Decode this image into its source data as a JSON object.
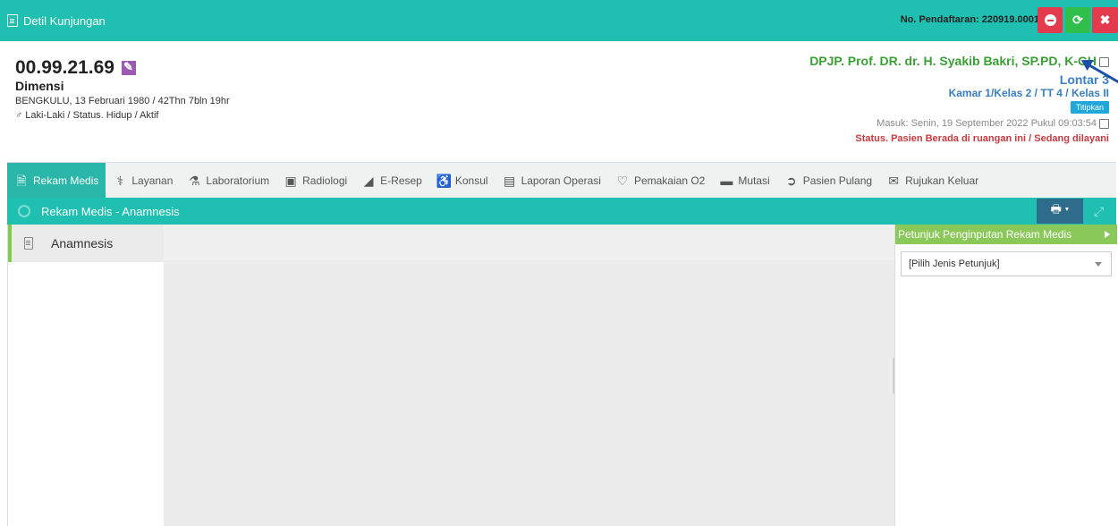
{
  "header": {
    "title": "Detil Kunjungan",
    "registration": "No. Pendaftaran: 220919.0001",
    "buttons": {
      "cancel_icon": "minus-circle-icon",
      "refresh_icon": "refresh-icon",
      "close_icon": "close-icon"
    }
  },
  "patient": {
    "id": "00.99.21.69",
    "name": "Dimensi",
    "dob": "BENGKULU, 13 Februari 1980 / 42Thn 7bln 19hr",
    "gender_status": "♂ Laki-Laki / Status. Hidup / Aktif"
  },
  "visit": {
    "dpjp": "DPJP. Prof. DR. dr. H. Syakib Bakri, SP.PD, K-GH",
    "room": "Lontar 3",
    "kamar": "Kamar 1/Kelas 2 / TT 4 / Kelas II",
    "titip_label": "Titipkan",
    "masuk": "Masuk: Senin, 19 September 2022 Pukul 09:03:54",
    "status": "Status. Pasien Berada di ruangan ini / Sedang dilayani"
  },
  "tabs": [
    {
      "label": "Rekam Medis",
      "icon": "document-icon"
    },
    {
      "label": "Layanan",
      "icon": "doctor-icon"
    },
    {
      "label": "Laboratorium",
      "icon": "flask-icon"
    },
    {
      "label": "Radiologi",
      "icon": "xray-icon"
    },
    {
      "label": "E-Resep",
      "icon": "pill-icon"
    },
    {
      "label": "Konsul",
      "icon": "wheelchair-icon"
    },
    {
      "label": "Laporan Operasi",
      "icon": "newspaper-icon"
    },
    {
      "label": "Pemakaian O2",
      "icon": "heart-icon"
    },
    {
      "label": "Mutasi",
      "icon": "bed-icon"
    },
    {
      "label": "Pasien Pulang",
      "icon": "arrow-circle-icon"
    },
    {
      "label": "Rujukan Keluar",
      "icon": "envelope-icon"
    }
  ],
  "section": {
    "title": "Rekam Medis - Anamnesis"
  },
  "sidebar": {
    "items": [
      {
        "label": "Anamnesis",
        "icon": "clipboard-icon"
      }
    ]
  },
  "guide": {
    "title": "Petunjuk Penginputan Rekam Medis",
    "select_value": "[Pilih Jenis Petunjuk]"
  },
  "colors": {
    "teal": "#1fbfb1",
    "green": "#3aa034",
    "blue": "#3a7fc1",
    "red": "#c9393f"
  }
}
